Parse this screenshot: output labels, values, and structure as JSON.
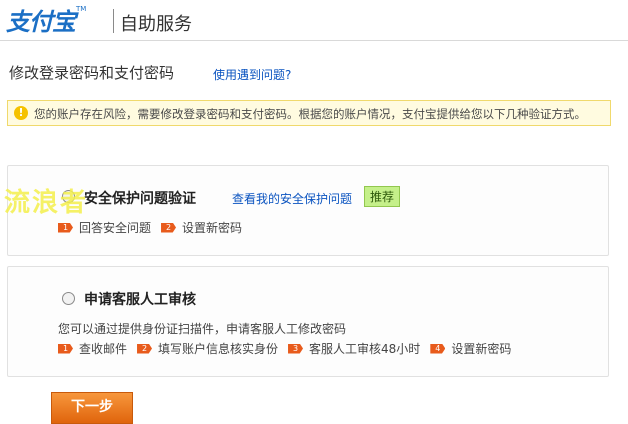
{
  "header": {
    "logo_text": "支付宝",
    "logo_tm": "TM",
    "title": "自助服务"
  },
  "page": {
    "title": "修改登录密码和支付密码",
    "help_link": "使用遇到问题?"
  },
  "warning": {
    "icon": "!",
    "text": "您的账户存在风险，需要修改登录密码和支付密码。根据您的账户情况，支付宝提供给您以下几种验证方式。"
  },
  "options": [
    {
      "title": "安全保护问题验证",
      "link": "查看我的安全保护问题",
      "badge": "推荐",
      "steps": [
        {
          "num": "1",
          "label": "回答安全问题"
        },
        {
          "num": "2",
          "label": "设置新密码"
        }
      ]
    },
    {
      "title": "申请客服人工审核",
      "description": "您可以通过提供身份证扫描件，申请客服人工修改密码",
      "steps": [
        {
          "num": "1",
          "label": "查收邮件"
        },
        {
          "num": "2",
          "label": "填写账户信息核实身份"
        },
        {
          "num": "3",
          "label": "客服人工审核48小时"
        },
        {
          "num": "4",
          "label": "设置新密码"
        }
      ]
    }
  ],
  "watermark": "流浪者",
  "next_button": "下一步"
}
